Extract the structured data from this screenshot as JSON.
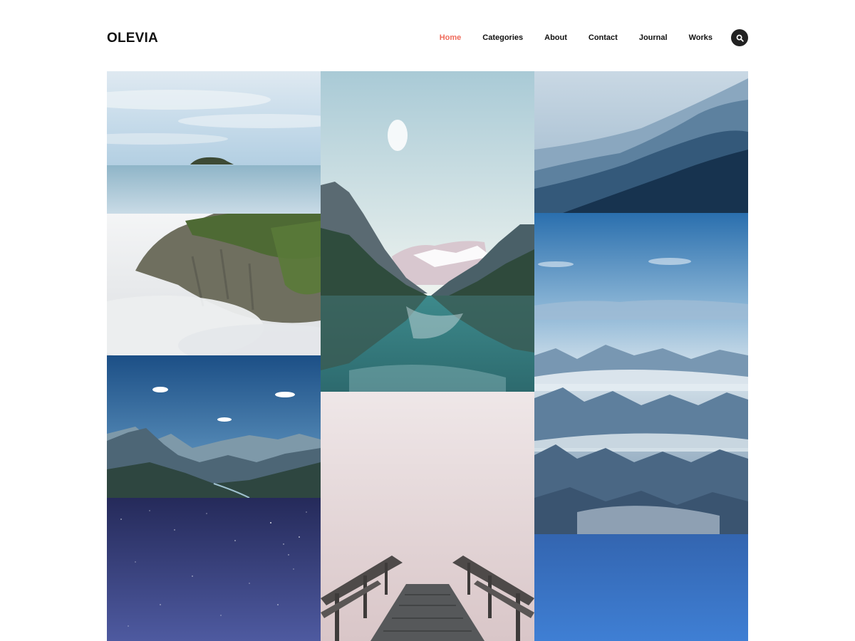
{
  "header": {
    "logo": "OLEVIA",
    "nav": [
      {
        "label": "Home",
        "active": true
      },
      {
        "label": "Categories",
        "active": false
      },
      {
        "label": "About",
        "active": false
      },
      {
        "label": "Contact",
        "active": false
      },
      {
        "label": "Journal",
        "active": false
      },
      {
        "label": "Works",
        "active": false
      }
    ],
    "search_icon": "search-icon"
  },
  "colors": {
    "accent": "#ef6b5b",
    "text": "#111111",
    "search_bg": "#222222"
  },
  "gallery": {
    "photos": [
      {
        "subject": "island-seascape"
      },
      {
        "subject": "misty-cliff"
      },
      {
        "subject": "mountain-valley"
      },
      {
        "subject": "starry-sky"
      },
      {
        "subject": "mountain-lake-reflection"
      },
      {
        "subject": "foggy-stairs"
      },
      {
        "subject": "blue-mountain-ridges"
      },
      {
        "subject": "aerial-mountains-clouds"
      },
      {
        "subject": "blue-sky"
      }
    ]
  }
}
